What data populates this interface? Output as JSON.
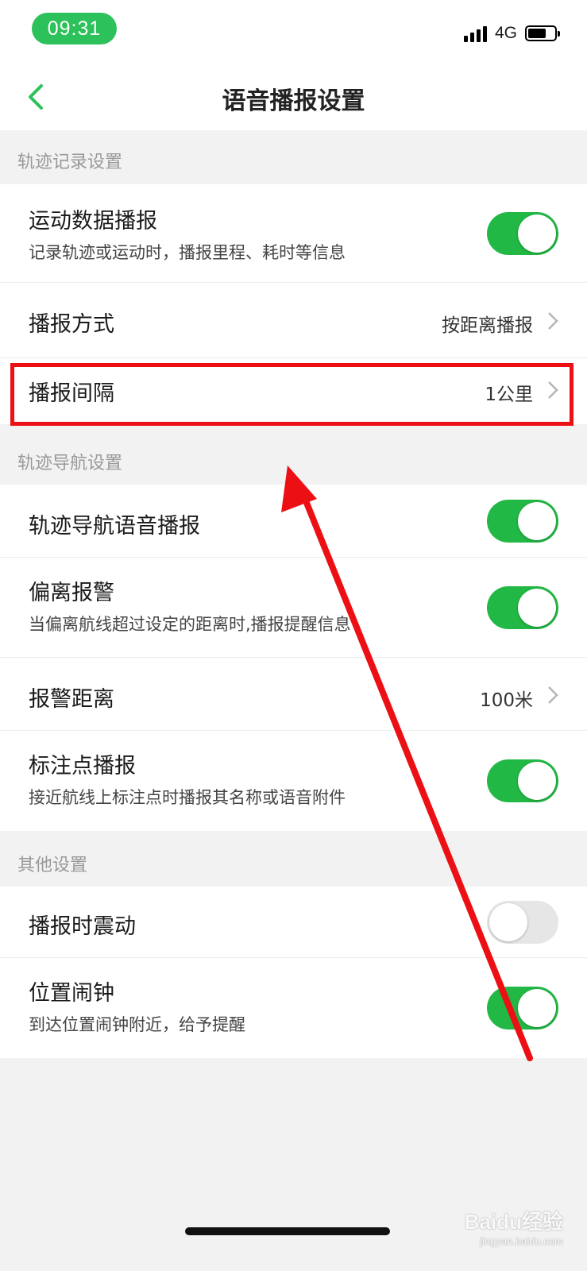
{
  "status_bar": {
    "time": "09:31",
    "network": "4G"
  },
  "nav": {
    "title": "语音播报设置"
  },
  "sections": [
    {
      "header": "轨迹记录设置",
      "rows": [
        {
          "title": "运动数据播报",
          "subtitle": "记录轨迹或运动时，播报里程、耗时等信息",
          "toggle": true
        },
        {
          "title": "播报方式",
          "value": "按距离播报"
        },
        {
          "title": "播报间隔",
          "value": "1公里"
        }
      ]
    },
    {
      "header": "轨迹导航设置",
      "rows": [
        {
          "title": "轨迹导航语音播报",
          "toggle": true
        },
        {
          "title": "偏离报警",
          "subtitle": "当偏离航线超过设定的距离时,播报提醒信息",
          "toggle": true
        },
        {
          "title": "报警距离",
          "value": "100米"
        },
        {
          "title": "标注点播报",
          "subtitle": "接近航线上标注点时播报其名称或语音附件",
          "toggle": true
        }
      ]
    },
    {
      "header": "其他设置",
      "rows": [
        {
          "title": "播报时震动",
          "toggle": false
        },
        {
          "title": "位置闹钟",
          "subtitle": "到达位置闹钟附近，给予提醒",
          "toggle": true
        }
      ]
    }
  ],
  "annotation": {
    "highlight_color": "#ec0f14",
    "highlighted_row": "播报间隔"
  },
  "watermark": {
    "brand": "Baidu经验",
    "url": "jingyan.baidu.com"
  },
  "colors": {
    "accent": "#2cc15a",
    "toggle_on": "#22b845",
    "toggle_off": "#e6e6e6"
  }
}
